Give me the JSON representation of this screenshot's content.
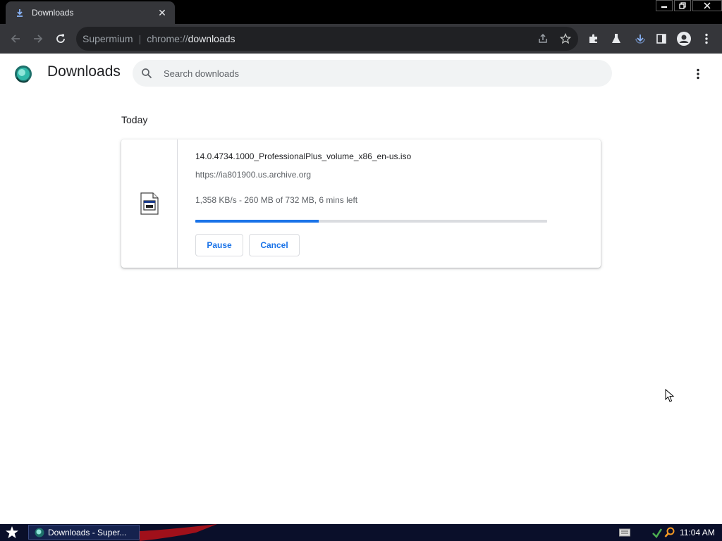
{
  "tab": {
    "title": "Downloads",
    "close_glyph": "✕",
    "icon": "download-icon"
  },
  "window_controls": {
    "minimize": "▬",
    "restore": "❐",
    "close": "✕"
  },
  "toolbar": {
    "omnibox": {
      "site_name": "Supermium",
      "separator": "|",
      "scheme": "chrome://",
      "path": "downloads"
    },
    "icons": [
      "back-icon",
      "forward-icon",
      "reload-icon",
      "share-icon",
      "star-icon",
      "extensions-icon",
      "labs-icon",
      "downloads-indicator-icon",
      "side-panel-icon",
      "profile-icon",
      "menu-icon"
    ]
  },
  "downloads_page": {
    "title": "Downloads",
    "search": {
      "placeholder": "Search downloads",
      "value": ""
    },
    "date_heading": "Today",
    "items": [
      {
        "file_name": "14.0.4734.1000_ProfessionalPlus_volume_x86_en-us.iso",
        "url": "https://ia801900.us.archive.org",
        "status": "1,358 KB/s - 260 MB of 732 MB, 6 mins left",
        "progress_fraction": 0.35,
        "pause_label": "Pause",
        "cancel_label": "Cancel"
      }
    ]
  },
  "taskbar": {
    "task_label": "Downloads - Super...",
    "clock": "11:04 AM"
  },
  "colors": {
    "accent": "#1a73e8",
    "toolbar_bg": "#35363a",
    "tabstrip_bg": "#000000",
    "taskbar_bg": "#0a0f2a"
  }
}
